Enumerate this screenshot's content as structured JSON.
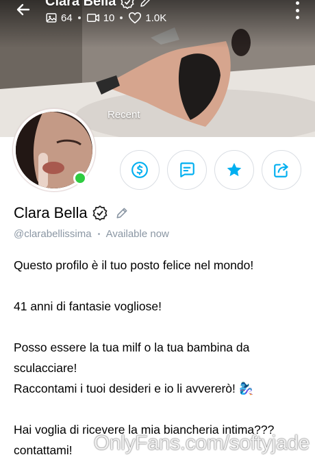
{
  "header": {
    "name": "Clara Bella",
    "stats": {
      "photos": "64",
      "videos": "10",
      "likes": "1.0K"
    },
    "recent_label": "Recent",
    "icons": {
      "back": "arrow-left-icon",
      "photos": "image-icon",
      "videos": "video-icon",
      "likes": "heart-icon",
      "verified": "verified-badge-icon",
      "edit": "pencil-icon",
      "more": "more-vertical-icon"
    }
  },
  "profile": {
    "name": "Clara Bella",
    "handle": "@clarabellissima",
    "status": "Available now",
    "online": true
  },
  "actions": [
    {
      "name": "tip",
      "icon": "dollar-circle-icon"
    },
    {
      "name": "message",
      "icon": "message-icon"
    },
    {
      "name": "favorite",
      "icon": "star-icon"
    },
    {
      "name": "share",
      "icon": "share-icon"
    }
  ],
  "bio": {
    "p1": "Questo profilo è il tuo posto felice nel mondo!",
    "p2": "41 anni di fantasie vogliose!",
    "p3a": "Posso essere la tua milf o la tua bambina da sculacciare!",
    "p3b": "Raccontami i tuoi desideri e io li avvererò! 🧞‍♀️",
    "p4": "Hai voglia di ricevere la mia biancheria intima???contattami!"
  },
  "watermark": "OnlyFans.com/softyjade",
  "colors": {
    "accent": "#00aff0",
    "online": "#2ecc40",
    "muted": "#8a96a3"
  }
}
